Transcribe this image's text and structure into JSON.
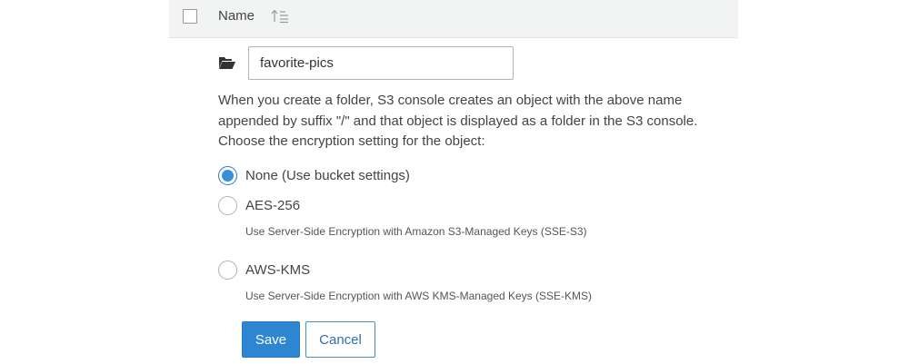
{
  "table_header": {
    "column_name_label": "Name",
    "sort_icon": "sort-ascending-icon"
  },
  "create_folder": {
    "folder_icon": "folder-open-icon",
    "folder_name_value": "favorite-pics",
    "description": "When you create a folder, S3 console creates an object with the above name appended by suffix \"/\" and that object is displayed as a folder in the S3 console. Choose the encryption setting for the object:",
    "encryption_options": [
      {
        "label": "None (Use bucket settings)",
        "helper": "",
        "selected": true
      },
      {
        "label": "AES-256",
        "helper": "Use Server-Side Encryption with Amazon S3-Managed Keys (SSE-S3)",
        "selected": false
      },
      {
        "label": "AWS-KMS",
        "helper": "Use Server-Side Encryption with AWS KMS-Managed Keys (SSE-KMS)",
        "selected": false
      }
    ],
    "save_label": "Save",
    "cancel_label": "Cancel"
  },
  "colors": {
    "header_background": "#f2f3f3",
    "radio_selected": "#3a8ddb",
    "primary_button": "#2e86d2",
    "cancel_border": "#4a90c8"
  }
}
